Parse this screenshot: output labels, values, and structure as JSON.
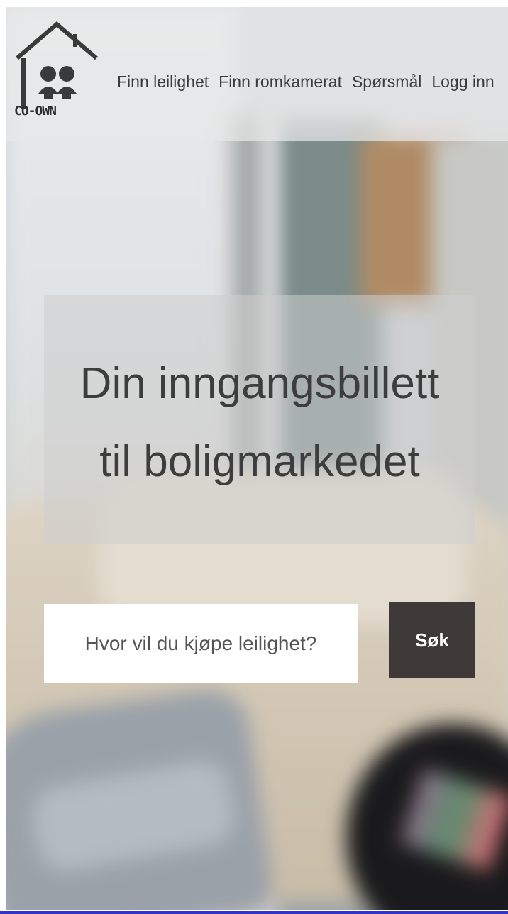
{
  "brand": {
    "logo_text": "CO-OWN",
    "logo_icon": "house-with-two-people-icon"
  },
  "nav": {
    "items": [
      {
        "label": "Finn leilighet"
      },
      {
        "label": "Finn romkamerat"
      },
      {
        "label": "Spørsmål"
      },
      {
        "label": "Logg inn"
      }
    ]
  },
  "hero": {
    "title_line1": "Din inngangsbillett",
    "title_line2": "til boligmarkedet"
  },
  "search": {
    "placeholder": "Hvor vil du kjøpe leilighet?",
    "value": "",
    "button_label": "Søk"
  },
  "colors": {
    "button_bg": "#3f3a39",
    "text_dark": "#3d3d3d",
    "header_overlay": "#e8e8e8"
  }
}
